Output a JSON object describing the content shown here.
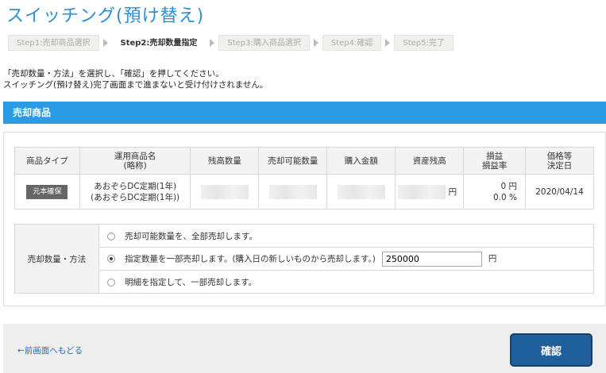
{
  "title": "スイッチング(預け替え)",
  "steps": [
    {
      "label": "Step1:売却商品選択"
    },
    {
      "label": "Step2:売却数量指定"
    },
    {
      "label": "Step3:購入商品選択"
    },
    {
      "label": "Step4:確認"
    },
    {
      "label": "Step5:完了"
    }
  ],
  "instructions": {
    "line1": "「売却数量・方法」を選択し、「確認」を押してください。",
    "line2": "スイッチング(預け替え)完了画面まで進まないと受け付けされません。"
  },
  "section_header": "売却商品",
  "table": {
    "headers": {
      "type": "商品タイプ",
      "name_1": "運用商品名",
      "name_2": "(略称)",
      "balance_qty": "残高数量",
      "sellable_qty": "売却可能数量",
      "purchase_amt": "購入金額",
      "asset_balance": "資産残高",
      "pl_1": "損益",
      "pl_2": "損益率",
      "price_1": "価格等",
      "price_2": "決定日"
    },
    "row": {
      "type_badge": "元本確保",
      "name_1": "あおぞらDC定期(1年)",
      "name_2": "(あおぞらDC定期(1年))",
      "asset_unit": "円",
      "pl_amount": "0 円",
      "pl_rate": "0.0 %",
      "price_date": "2020/04/14"
    }
  },
  "method": {
    "label": "売却数量・方法",
    "option_all": "売却可能数量を、全部売却します。",
    "option_partial": "指定数量を一部売却します。(購入日の新しいものから売却します。)",
    "option_detail": "明細を指定して、一部売却します。",
    "quantity_value": "250000",
    "quantity_unit": "円",
    "selected": "partial"
  },
  "footer": {
    "back_label": "←前画面へもどる",
    "confirm_label": "確認"
  },
  "colors": {
    "title": "#2a8fd6",
    "section_header": "#2b9be6",
    "confirm_button": "#1e5f9c",
    "link": "#2a6fc9"
  }
}
